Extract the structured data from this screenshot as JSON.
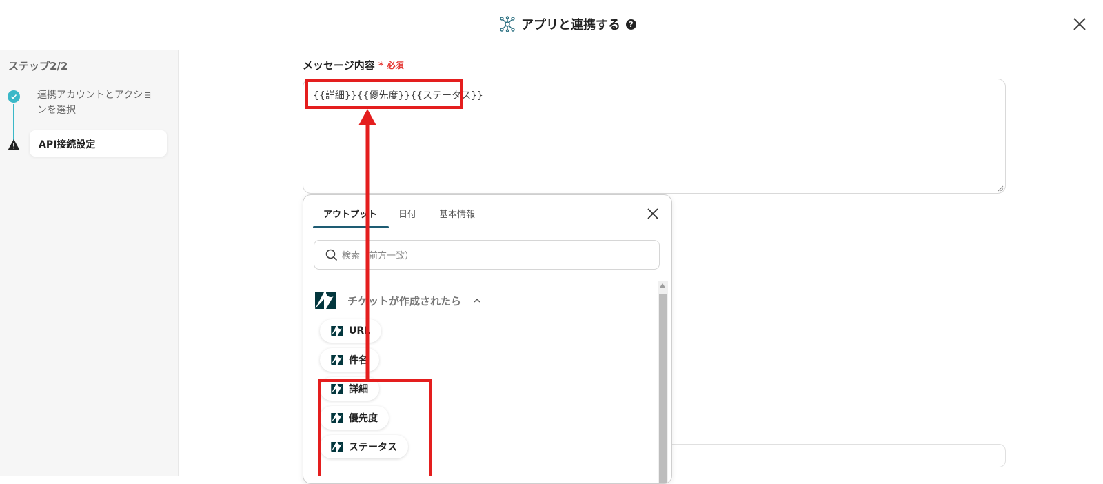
{
  "header": {
    "title": "アプリと連携する",
    "help_icon": "?",
    "icons": {
      "app": "network-icon",
      "close": "close-icon",
      "help": "question-circle-icon"
    }
  },
  "sidebar": {
    "step_label": "ステップ2/2",
    "steps": [
      {
        "label": "連携アカウントとアクションを選択",
        "status": "complete",
        "icon": "check-circle-icon"
      },
      {
        "label": "API接続設定",
        "status": "warning",
        "icon": "warning-icon",
        "active": true
      }
    ]
  },
  "form": {
    "message_label": "メッセージ内容",
    "required_mark": "*",
    "required_text": "必須",
    "message_value": "{{詳細}}{{優先度}}{{ステータス}}"
  },
  "panel": {
    "tabs": [
      {
        "label": "アウトプット",
        "active": true
      },
      {
        "label": "日付",
        "active": false
      },
      {
        "label": "基本情報",
        "active": false
      }
    ],
    "search_placeholder": "検索（前方一致）",
    "group_title": "チケットが作成されたら",
    "items": [
      "URL",
      "件名",
      "詳細",
      "優先度",
      "ステータス"
    ]
  },
  "colors": {
    "accent": "#3bb8c8",
    "tab_underline": "#1e5c73",
    "required": "#e53935",
    "annotation": "#e41e1e",
    "zendesk_logo": "#03363d"
  }
}
